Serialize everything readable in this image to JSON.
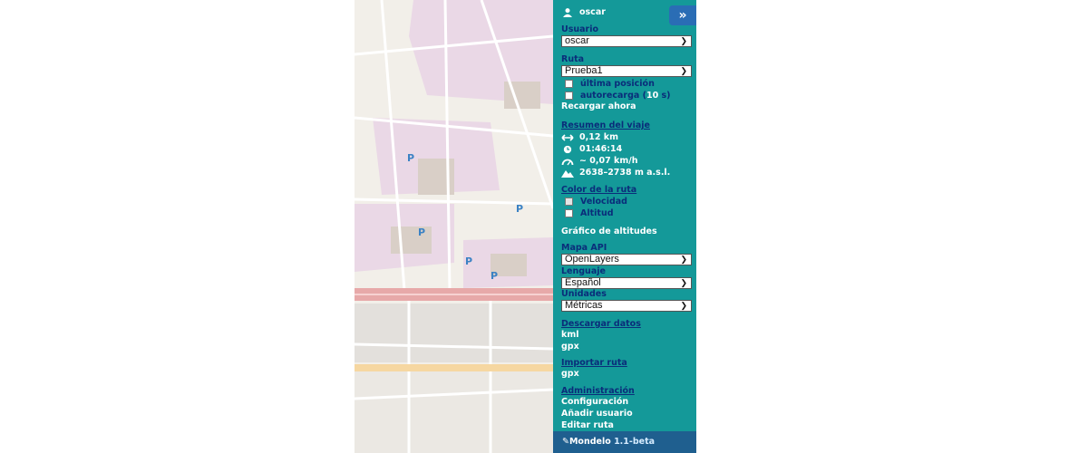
{
  "user": {
    "name": "oscar"
  },
  "usuario": {
    "label": "Usuario",
    "selected": "oscar"
  },
  "ruta": {
    "label": "Ruta",
    "selected": "Prueba1",
    "last_position_label": "última posición",
    "autoreload_prefix": "autorecarga (",
    "autoreload_value": "10",
    "autoreload_suffix": " s)",
    "reload_now": "Recargar ahora"
  },
  "summary": {
    "title": "Resumen del viaje",
    "distance": "0,12 km",
    "time": "01:46:14",
    "speed": "~ 0,07 km/h",
    "altitude": "2638–2738 m a.s.l."
  },
  "route_color": {
    "title": "Color de la ruta",
    "speed": "Velocidad",
    "altitude": "Altitud"
  },
  "altitude_chart": "Gráfico de altitudes",
  "map_api": {
    "label": "Mapa API",
    "selected": "OpenLayers"
  },
  "language": {
    "label": "Lenguaje",
    "selected": "Español"
  },
  "units": {
    "label": "Unidades",
    "selected": "Métricas"
  },
  "download": {
    "title": "Descargar datos",
    "kml": "kml",
    "gpx": "gpx"
  },
  "import": {
    "title": "Importar ruta",
    "gpx": "gpx"
  },
  "admin": {
    "title": "Administración",
    "config": "Configuración",
    "add_user": "Añadir usuario",
    "edit_route": "Editar ruta"
  },
  "footer": {
    "app": "Mondelo",
    "version": "1.1-beta"
  },
  "colors": {
    "panel": "#149999",
    "section_link": "#0a2d7a",
    "footer": "#1f5f8f",
    "expand_button": "#2a6db5"
  },
  "icons": [
    "user-icon",
    "double-chevron-right-icon",
    "distance-arrows-icon",
    "clock-icon",
    "speedometer-icon",
    "mountain-icon",
    "pencil-icon"
  ]
}
